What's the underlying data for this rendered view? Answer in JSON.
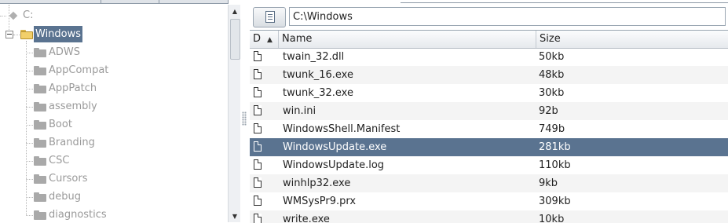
{
  "window": {
    "current_path": "C:\\Windows"
  },
  "tree": {
    "root_label": "C:",
    "expanded_label": "Windows",
    "children": [
      {
        "label": "ADWS"
      },
      {
        "label": "AppCompat"
      },
      {
        "label": "AppPatch"
      },
      {
        "label": "assembly"
      },
      {
        "label": "Boot"
      },
      {
        "label": "Branding"
      },
      {
        "label": "CSC"
      },
      {
        "label": "Cursors"
      },
      {
        "label": "debug"
      },
      {
        "label": "diagnostics"
      }
    ]
  },
  "table": {
    "columns": {
      "d": "D",
      "name": "Name",
      "size": "Size"
    },
    "sort_indicator": "▲",
    "rows": [
      {
        "name": "twain_32.dll",
        "size": "50kb"
      },
      {
        "name": "twunk_16.exe",
        "size": "48kb"
      },
      {
        "name": "twunk_32.exe",
        "size": "30kb"
      },
      {
        "name": "win.ini",
        "size": "92b"
      },
      {
        "name": "WindowsShell.Manifest",
        "size": "749b"
      },
      {
        "name": "WindowsUpdate.exe",
        "size": "281kb",
        "selected": true
      },
      {
        "name": "WindowsUpdate.log",
        "size": "110kb"
      },
      {
        "name": "winhlp32.exe",
        "size": "9kb"
      },
      {
        "name": "WMSysPr9.prx",
        "size": "309kb"
      },
      {
        "name": "write.exe",
        "size": "10kb"
      }
    ]
  },
  "icons": {
    "drive": "drive-icon",
    "folder": "folder-icon",
    "file": "file-icon",
    "copy_path": "copy-path-icon"
  },
  "colors": {
    "selection": "#5a7390",
    "dim_text": "#9a9a9a"
  }
}
